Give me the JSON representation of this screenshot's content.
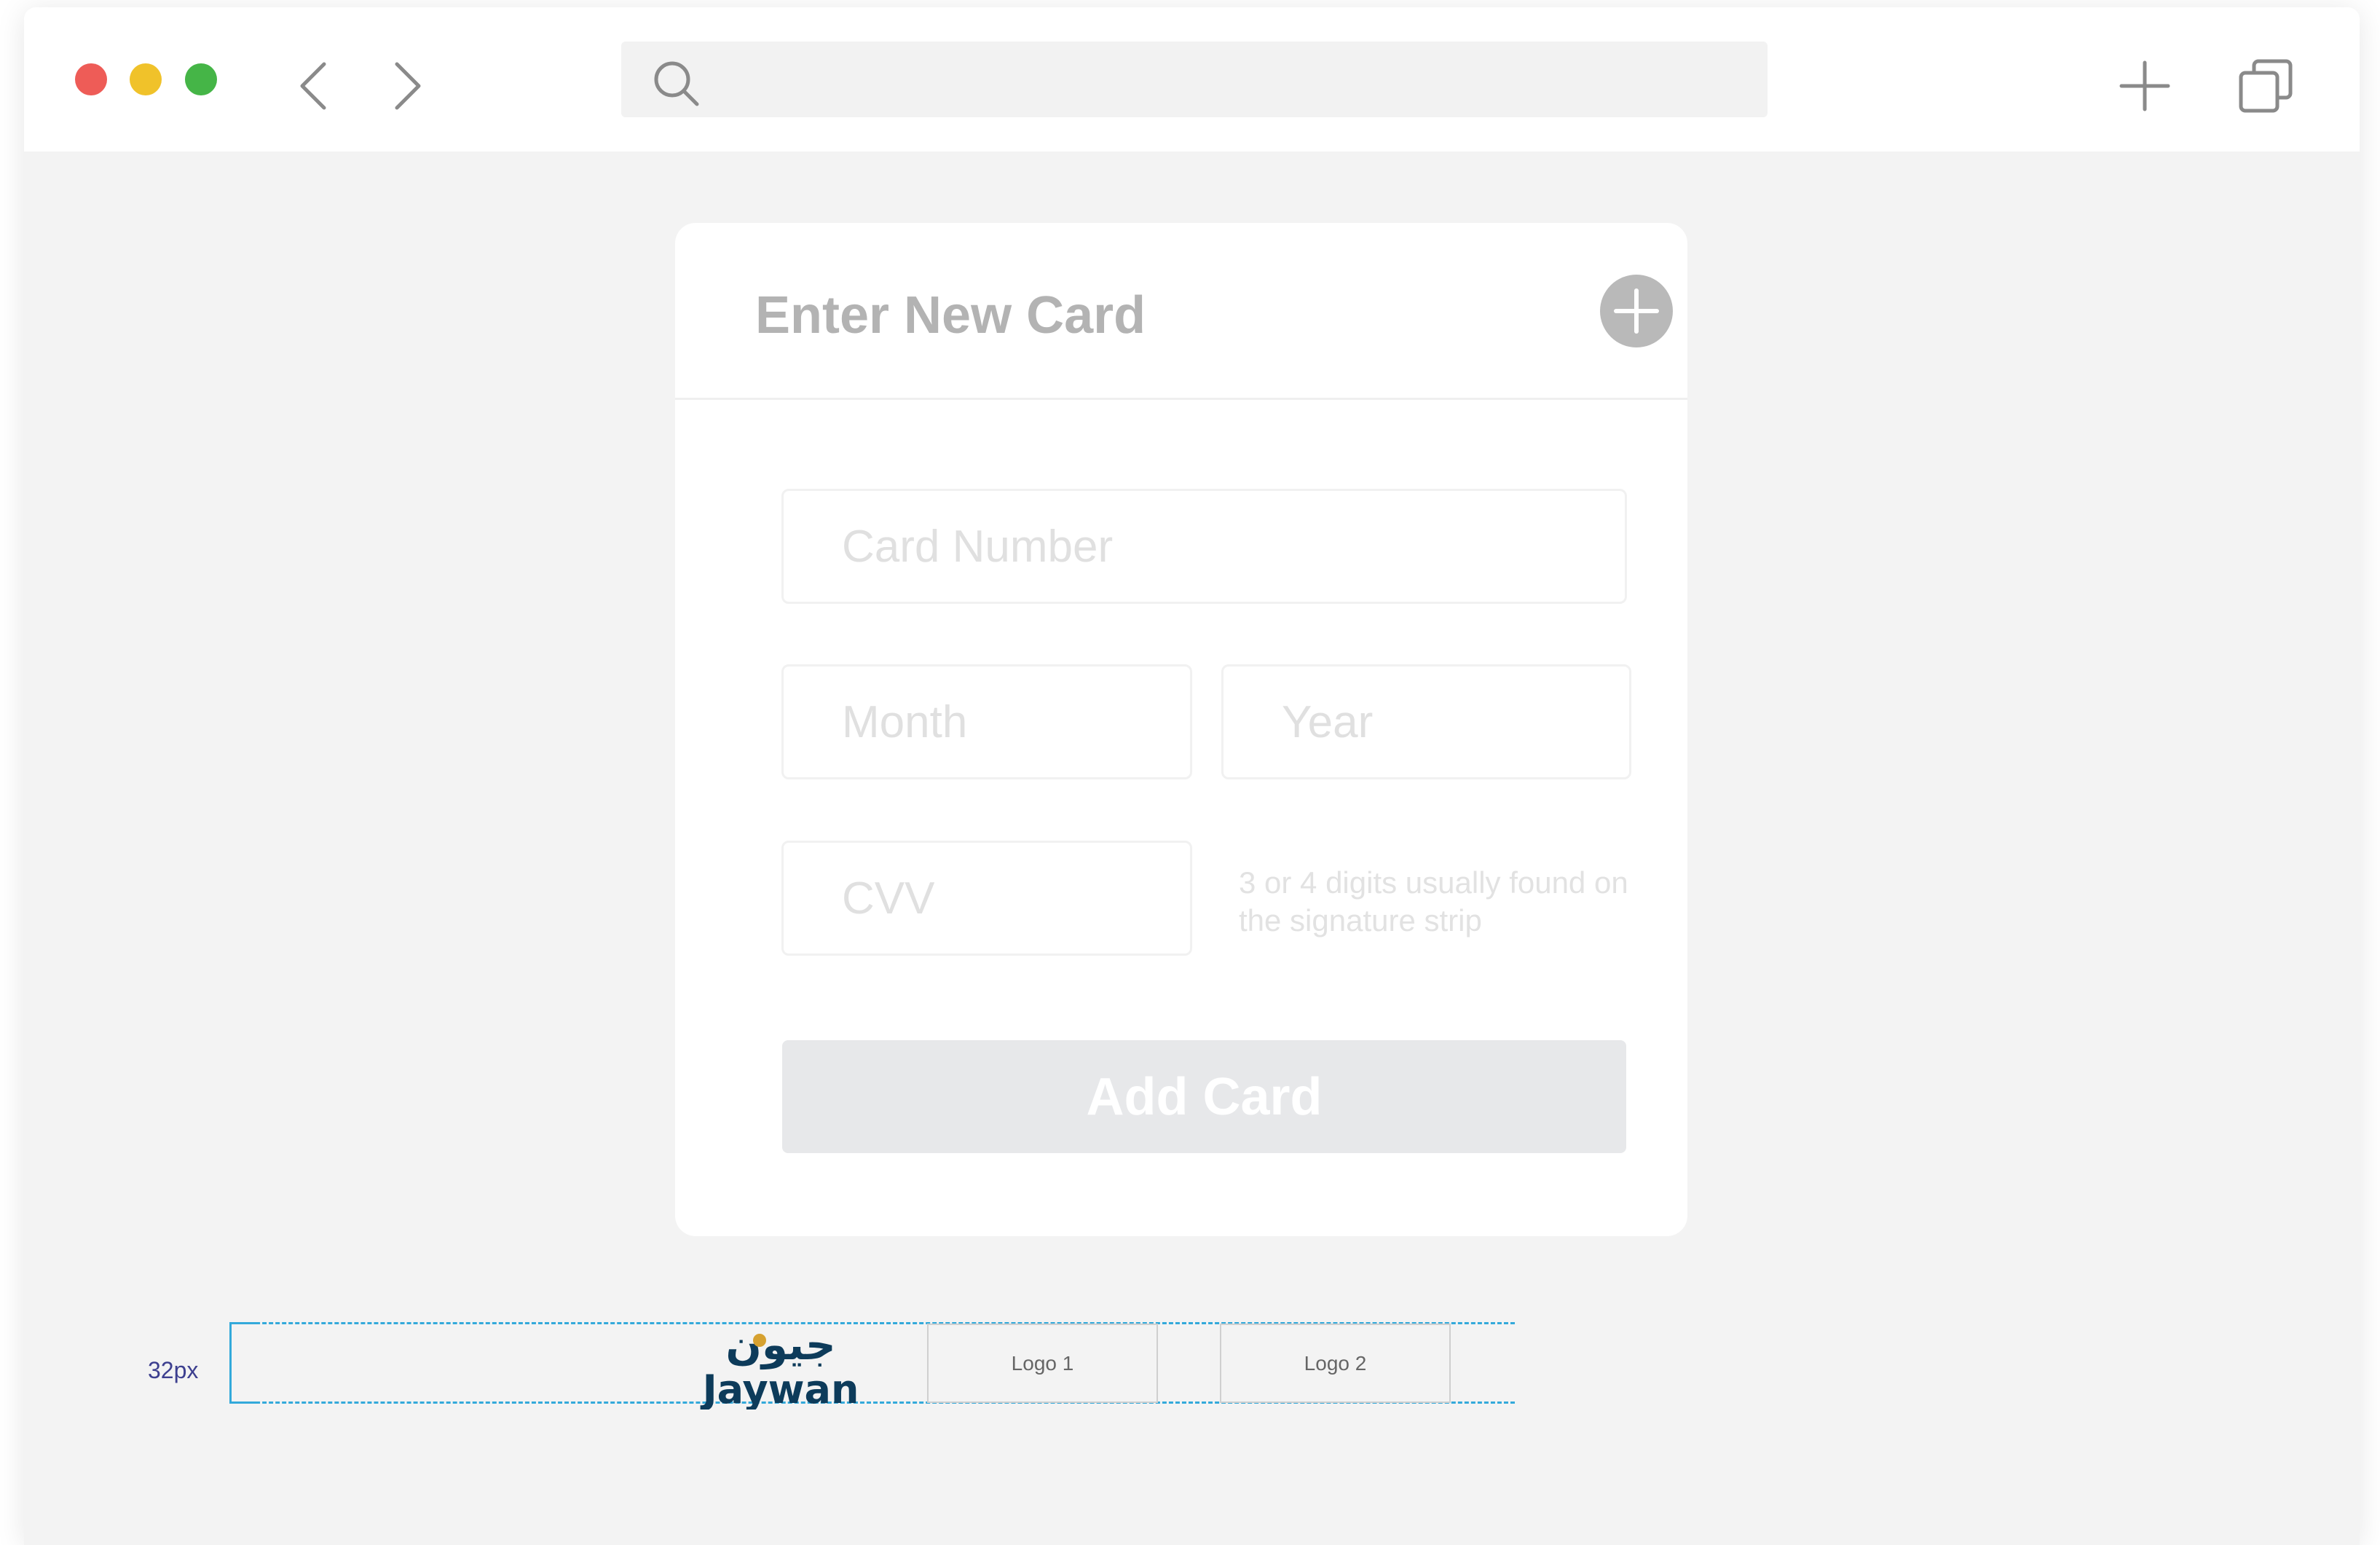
{
  "browser": {
    "address_value": "",
    "icons": {
      "back": "chevron-left-icon",
      "forward": "chevron-right-icon",
      "search": "search-icon",
      "new_tab": "plus-icon",
      "tabs": "tabs-icon"
    },
    "traffic_lights": {
      "close": "#ee5c57",
      "minimize": "#f0c22a",
      "maximize": "#45b547"
    }
  },
  "card_form": {
    "title": "Enter New Card",
    "fields": {
      "card_number": {
        "placeholder": "Card Number",
        "value": ""
      },
      "month": {
        "placeholder": "Month",
        "value": ""
      },
      "year": {
        "placeholder": "Year",
        "value": ""
      },
      "cvv": {
        "placeholder": "CVV",
        "value": ""
      }
    },
    "cvv_hint": "3 or 4 digits usually found on the signature strip",
    "submit_label": "Add Card"
  },
  "spec": {
    "height_label": "32px",
    "logos": {
      "jaywan_arabic": "جيون",
      "jaywan": "Jaywan",
      "logo1": "Logo 1",
      "logo2": "Logo 2"
    }
  },
  "colors": {
    "window_bg": "#f3f3f3",
    "card_bg": "#ffffff",
    "title_text": "#b3b3b3",
    "disabled_button": "#e7e8ea",
    "guide_line": "#33a9da",
    "jaywan_blue": "#0d3b5a",
    "jaywan_gold": "#d6a130"
  }
}
